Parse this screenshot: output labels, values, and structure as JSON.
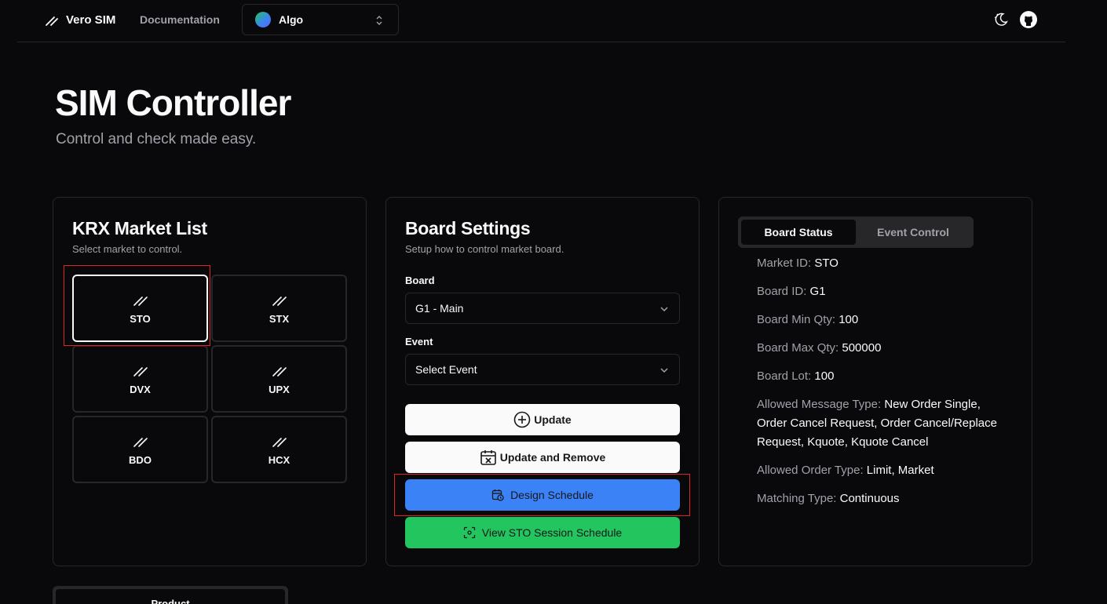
{
  "header": {
    "brand": "Vero SIM",
    "nav_documentation": "Documentation",
    "switcher_label": "Algo"
  },
  "page": {
    "title": "SIM Controller",
    "subtitle": "Control and check made easy."
  },
  "market_list": {
    "title": "KRX Market List",
    "description": "Select market to control.",
    "markets": [
      {
        "label": "STO",
        "active": true
      },
      {
        "label": "STX",
        "active": false
      },
      {
        "label": "DVX",
        "active": false
      },
      {
        "label": "UPX",
        "active": false
      },
      {
        "label": "BDO",
        "active": false
      },
      {
        "label": "HCX",
        "active": false
      }
    ]
  },
  "board_settings": {
    "title": "Board Settings",
    "description": "Setup how to control market board.",
    "board_label": "Board",
    "board_value": "G1 - Main",
    "event_label": "Event",
    "event_value": "Select Event",
    "update_button": "Update",
    "update_remove_button": "Update and Remove",
    "design_schedule_button": "Design Schedule",
    "view_schedule_button": "View STO Session Schedule"
  },
  "board_status": {
    "tabs": [
      "Board Status",
      "Event Control"
    ],
    "rows": [
      {
        "label": "Market ID: ",
        "value": "STO"
      },
      {
        "label": "Board ID: ",
        "value": "G1"
      },
      {
        "label": "Board Min Qty: ",
        "value": "100"
      },
      {
        "label": "Board Max Qty: ",
        "value": "500000"
      },
      {
        "label": "Board Lot: ",
        "value": "100"
      },
      {
        "label": "Allowed Message Type: ",
        "value": "New Order Single, Order Cancel Request, Order Cancel/Replace Request, Kquote, Kquote Cancel"
      },
      {
        "label": "Allowed Order Type: ",
        "value": "Limit, Market"
      },
      {
        "label": "Matching Type: ",
        "value": "Continuous"
      }
    ]
  },
  "product_tab": "Product",
  "colors": {
    "background": "#09090b",
    "border": "#27272a",
    "blue": "#3b82f6",
    "green": "#22c55e",
    "highlight": "#dc2626"
  }
}
